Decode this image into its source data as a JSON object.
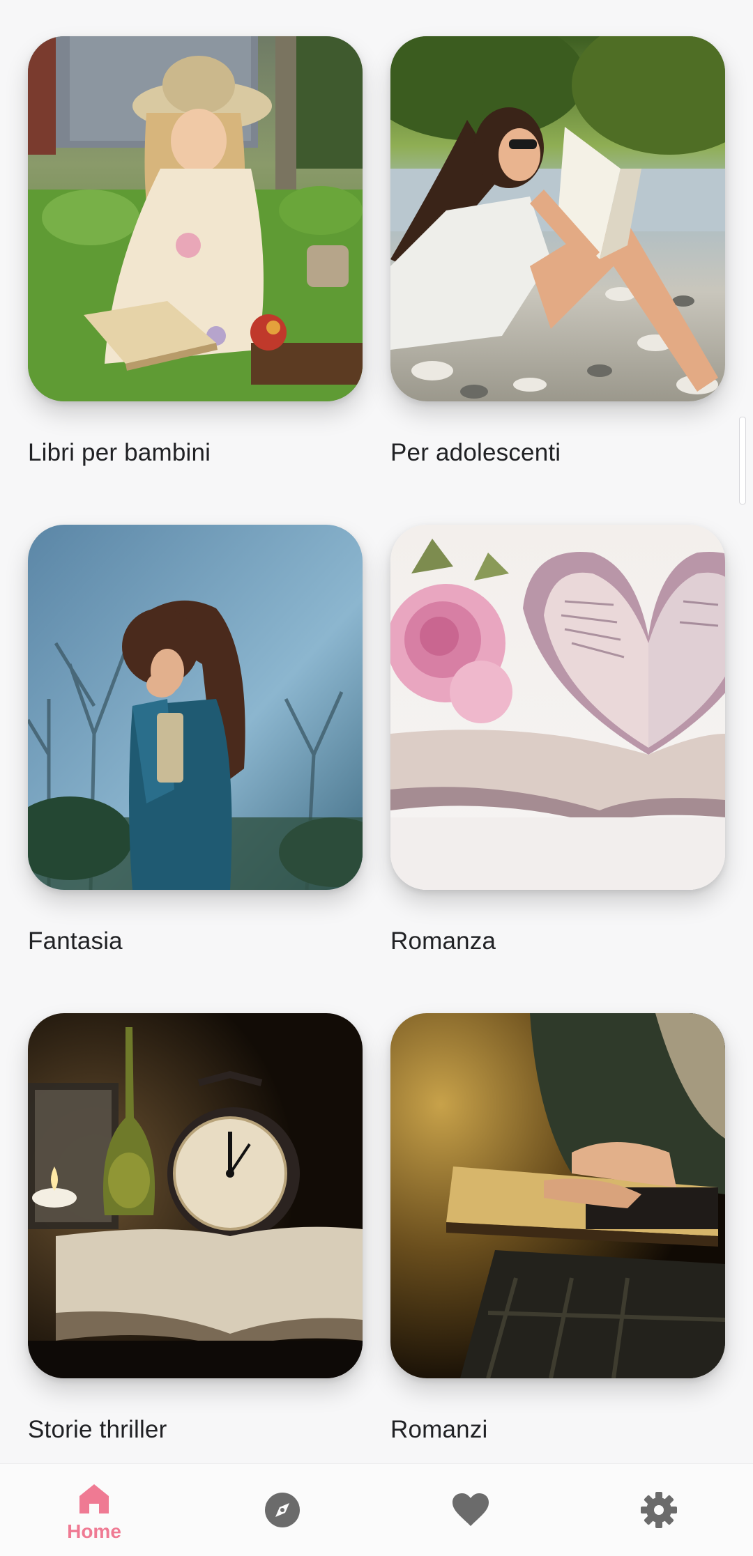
{
  "categories": [
    {
      "label": "Libri per bambini",
      "image": "girl-reading-in-garden"
    },
    {
      "label": "Per adolescenti",
      "image": "woman-reading-by-river"
    },
    {
      "label": "Fantasia",
      "image": "girl-in-misty-forest"
    },
    {
      "label": "Romanza",
      "image": "heart-book-with-rose"
    },
    {
      "label": "Storie thriller",
      "image": "clock-candle-open-book"
    },
    {
      "label": "Romanzi",
      "image": "hands-on-book"
    }
  ],
  "bottom_nav": {
    "items": [
      {
        "label": "Home",
        "icon": "home-icon",
        "active": true
      },
      {
        "label": "",
        "icon": "compass-icon",
        "active": false
      },
      {
        "label": "",
        "icon": "heart-icon",
        "active": false
      },
      {
        "label": "",
        "icon": "gear-icon",
        "active": false
      }
    ],
    "active_color": "#ef7a93",
    "inactive_color": "#6b6b6b"
  }
}
